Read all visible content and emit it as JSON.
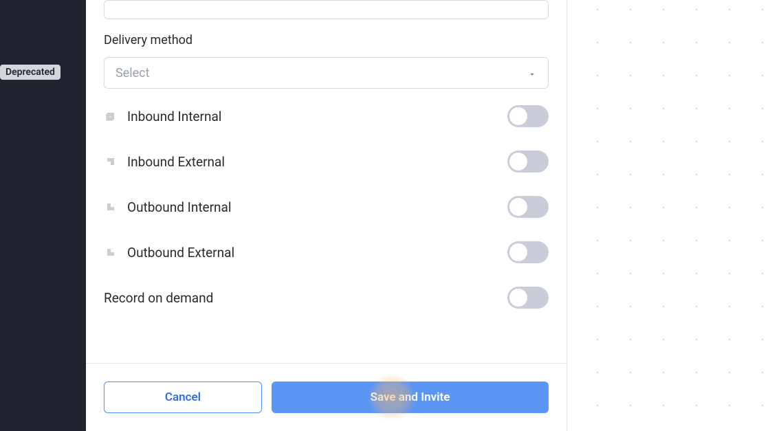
{
  "sidebar": {
    "deprecated_badge": "Deprecated"
  },
  "form": {
    "input_value": "",
    "delivery_label": "Delivery method",
    "delivery_select_placeholder": "Select",
    "toggles": {
      "inbound_internal": "Inbound Internal",
      "inbound_external": "Inbound External",
      "outbound_internal": "Outbound Internal",
      "outbound_external": "Outbound External",
      "record_on_demand": "Record on demand"
    }
  },
  "footer": {
    "cancel": "Cancel",
    "save": "Save and Invite"
  }
}
